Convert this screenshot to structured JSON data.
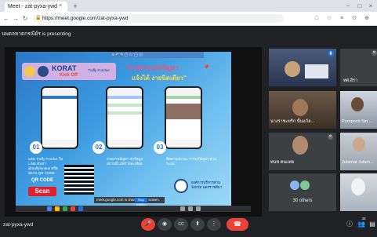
{
  "browser": {
    "tab_title": "Meet - zat-pyxa-ywd",
    "tab_close": "×",
    "new_tab": "+",
    "url": "https://meet.google.com/zat-pyxa-ywd",
    "window_controls": [
      "−",
      "□",
      "×"
    ],
    "nav": {
      "back": "←",
      "forward": "→",
      "reload": "↻"
    },
    "extension_icons": [
      "□",
      "☆",
      "≡",
      "⊙",
      "⊕"
    ]
  },
  "meet": {
    "presenting_text": "นพดลหาดกรณีย์ร is presenting",
    "meeting_code": "zat-pyxa-ywd",
    "others_count_label": "30 others",
    "participants": [
      {
        "name": ""
      },
      {
        "name": "ทศ.ลีรา"
      },
      {
        "name": "นางราชะพริก นั้นแก้ล..."
      },
      {
        "name": "Pornpoch Siri..."
      },
      {
        "name": "ทนช ตนแทย"
      },
      {
        "name": "Jutamat Jutam..."
      },
      {
        "name": ""
      }
    ],
    "controls": {
      "mic": "🎤",
      "camera": "◉",
      "captions": "CC",
      "present": "⬆",
      "more": "⋮",
      "end": "☎"
    },
    "right_controls": {
      "info": "ⓘ",
      "people": "👥",
      "people_badge": "38",
      "chat": "▤"
    }
  },
  "slide": {
    "toolbar_text": "≡ ↶ ↷ ▢ ▭ ◯ ⊡",
    "brand_title": "KORAT",
    "brand_sub_1": "Kick Off",
    "brand_sub_2": "Traffy Fondue",
    "headline_1": "\"ทางด่วนแจ้งปัญหา",
    "headline_2": "แจ้งได้ ง่ายนิดเดียว\"",
    "steps": [
      {
        "num": "01",
        "text": "แสน Traffy Fondue ใน LINE ค้นหา @traffyfondue หรือสแกน QR CODE"
      },
      {
        "num": "02",
        "text": "ถ่ายภาพปัญหา ส่งข้อมูลสถานที่ แจ้งรายละเอียด"
      },
      {
        "num": "03",
        "text": "ติดตามสถานะ การแก้ปัญหา ผ่านระบบ"
      }
    ],
    "qr_label": "QR CODE",
    "scan_label": "Scan",
    "gov_text": "องค์การบริหารส่วนจังหวัด นครราชสีมา",
    "status_text": "meet.google.com is sharing your screen.",
    "status_stop": "Stop sharing",
    "status_hide": "Hide"
  },
  "colors": {
    "accent": "#1a73e8",
    "danger": "#ea4335",
    "bg": "#202124"
  }
}
